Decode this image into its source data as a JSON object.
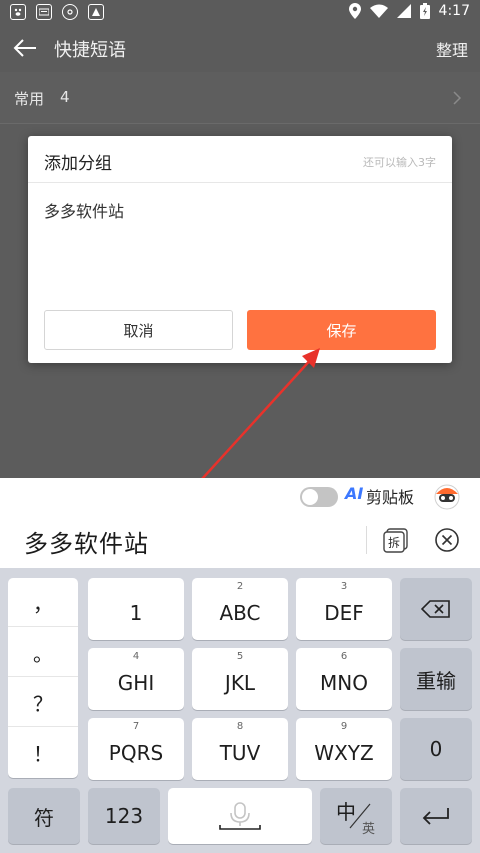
{
  "status_bar": {
    "time": "4:17",
    "left_icons": [
      "baidu-icon",
      "keyboard-icon",
      "settings-icon",
      "app-icon"
    ],
    "right_icons": [
      "location-icon",
      "wifi-icon",
      "signal-icon",
      "battery-icon"
    ]
  },
  "app_bar": {
    "title": "快捷短语",
    "action": "整理"
  },
  "group_list": [
    {
      "name": "常用",
      "count": "4"
    }
  ],
  "dialog": {
    "title": "添加分组",
    "hint": "还可以输入3字",
    "input_value": "多多软件站",
    "cancel_label": "取消",
    "save_label": "保存"
  },
  "ime_toolbar": {
    "toggle_on": false,
    "ai_label": "AI",
    "clipboard_label": "剪贴板"
  },
  "composing": {
    "text": "多多软件站",
    "split_label": "拆"
  },
  "keyboard": {
    "punctuation": [
      "，",
      "。",
      "？",
      "！"
    ],
    "rows": [
      [
        {
          "sub": "",
          "main": "1"
        },
        {
          "sub": "2",
          "main": "ABC"
        },
        {
          "sub": "3",
          "main": "DEF"
        }
      ],
      [
        {
          "sub": "4",
          "main": "GHI"
        },
        {
          "sub": "5",
          "main": "JKL"
        },
        {
          "sub": "6",
          "main": "MNO"
        }
      ],
      [
        {
          "sub": "7",
          "main": "PQRS"
        },
        {
          "sub": "8",
          "main": "TUV"
        },
        {
          "sub": "9",
          "main": "WXYZ"
        }
      ]
    ],
    "reenter_label": "重输",
    "zero_label": "0",
    "symbol_label": "符",
    "num_label": "123",
    "lang_main": "中",
    "lang_sub": "英"
  },
  "colors": {
    "accent": "#ff7240",
    "ai_blue": "#3c78ff",
    "annotation_red": "#e8322b"
  }
}
